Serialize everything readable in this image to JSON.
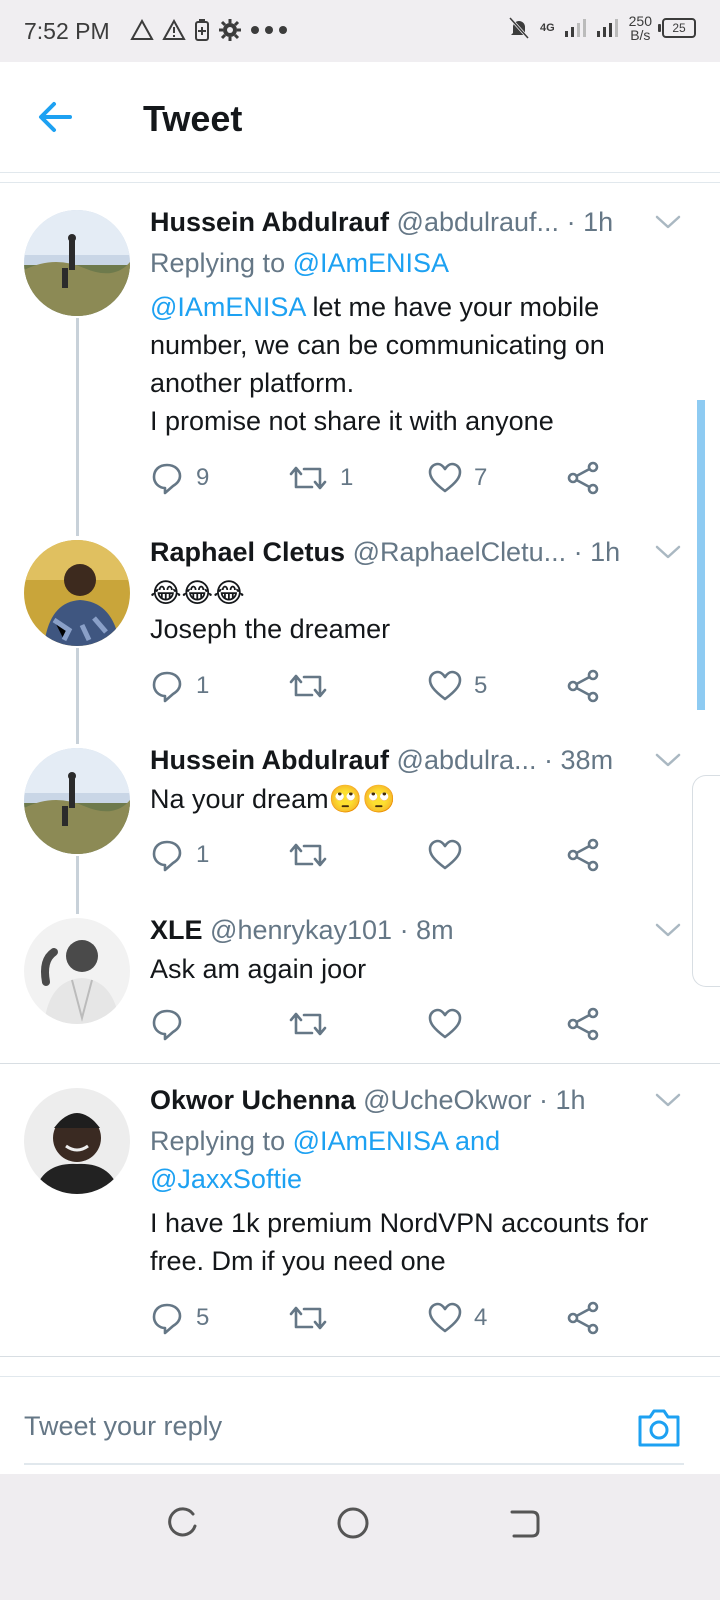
{
  "status_bar": {
    "time": "7:52 PM",
    "network_label": "4G",
    "speed_value": "250",
    "speed_unit": "B/s",
    "battery": "25"
  },
  "header": {
    "title": "Tweet",
    "back_icon": "arrow-left-icon"
  },
  "colors": {
    "accent": "#1da1f2",
    "muted": "#657786",
    "text": "#14171a"
  },
  "tweets": [
    {
      "name": "Hussein Abdulrauf",
      "handle": "@abdulrauf...",
      "time": "· 1h",
      "replying_prefix": "Replying to ",
      "replying_to": "@IAmENISA",
      "mention": "@IAmENISA",
      "text": " let me have your mobile number, we can be communicating on another platform.",
      "text2": "I promise not share it with anyone",
      "replies": "9",
      "retweets": "1",
      "likes": "7"
    },
    {
      "name": "Raphael Cletus",
      "handle": "@RaphaelCletu...",
      "time": "· 1h",
      "emoji": "😂😂😂",
      "text": "Joseph the dreamer",
      "replies": "1",
      "retweets": "",
      "likes": "5"
    },
    {
      "name": "Hussein Abdulrauf",
      "handle": "@abdulra...",
      "time": "· 38m",
      "text": "Na your dream🙄🙄",
      "replies": "1",
      "retweets": "",
      "likes": ""
    },
    {
      "name": "XLE",
      "handle": "@henrykay101",
      "time": "· 8m",
      "text": "Ask am again joor",
      "replies": "",
      "retweets": "",
      "likes": ""
    },
    {
      "name": "Okwor Uchenna",
      "handle": "@UcheOkwor",
      "time": "· 1h",
      "replying_prefix": "Replying to ",
      "replying_to": "@IAmENISA and",
      "replying_to2": "@JaxxSoftie",
      "text": "I have 1k premium NordVPN accounts for free. Dm if you need one",
      "replies": "5",
      "retweets": "",
      "likes": "4"
    }
  ],
  "reply_bar": {
    "placeholder": "Tweet your reply",
    "camera_icon": "camera-icon"
  },
  "nav_bar": {
    "recents": "recents-icon",
    "home": "home-icon",
    "back": "back-icon"
  }
}
